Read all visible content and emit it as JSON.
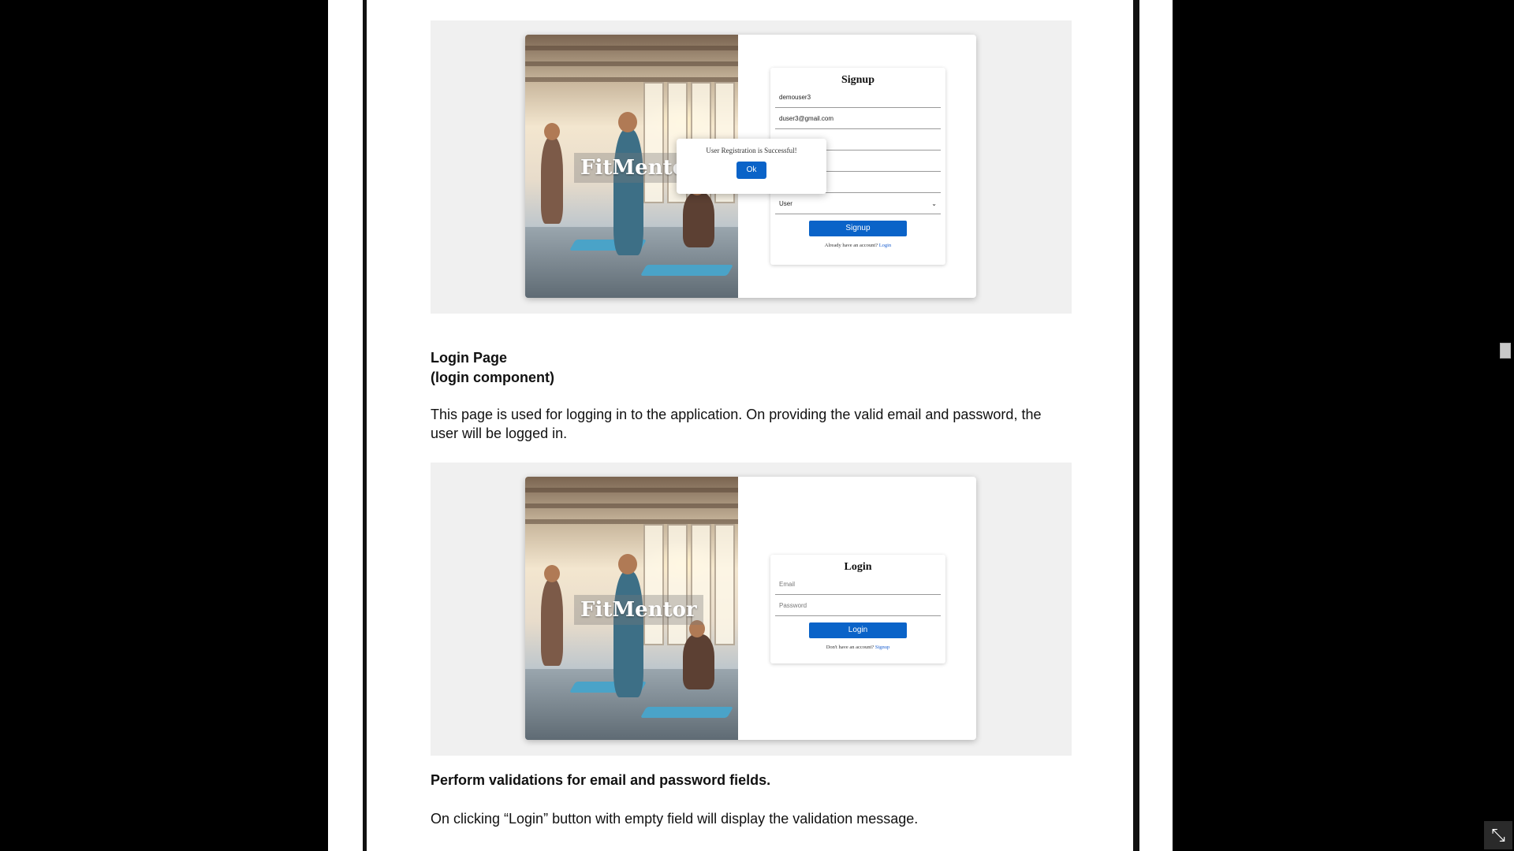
{
  "signup_figure": {
    "brand": "FitMentor",
    "title": "Signup",
    "username_value": "demouser3",
    "email_value": "duser3@gmail.com",
    "role_value": "User",
    "button": "Signup",
    "footer_text": "Already have an account?",
    "footer_link": "Login",
    "dialog_message": "User Registration is Successful!",
    "dialog_button": "Ok"
  },
  "section": {
    "heading": "Login Page",
    "component": "(login component)",
    "description": "This page is used for logging in to the application. On providing the valid email and password, the user will be logged in."
  },
  "login_figure": {
    "brand": "FitMentor",
    "title": "Login",
    "email_placeholder": "Email",
    "password_placeholder": "Password",
    "button": "Login",
    "footer_text": "Don't have an account?",
    "footer_link": "Signup"
  },
  "validation": {
    "heading": "Perform validations for email and password fields.",
    "note": "On clicking “Login” button with empty field will display the validation message."
  },
  "icons": {
    "exit_fullscreen": "exit-fullscreen-icon",
    "chevron": "chevron-down-icon"
  },
  "colors": {
    "accent": "#0a63c8",
    "link": "#1a5fd0",
    "figure_bg": "#f0f0f0"
  }
}
